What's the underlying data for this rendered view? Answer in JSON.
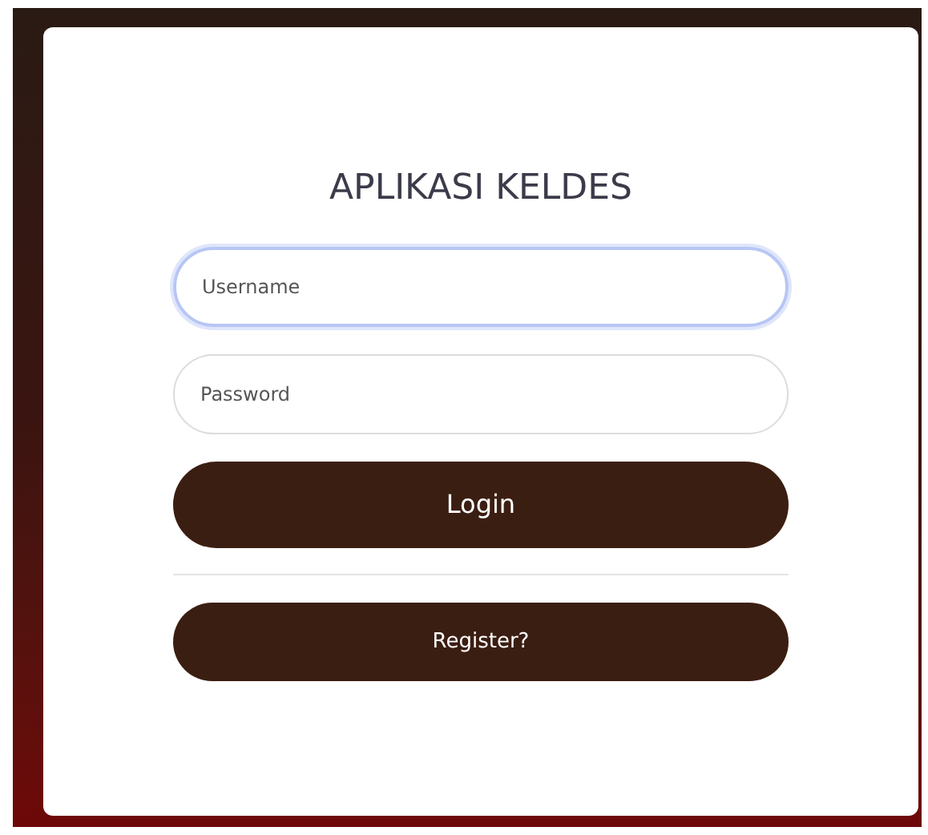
{
  "title": "APLIKASI KELDES",
  "fields": [
    {
      "placeholder": "Username",
      "focused": true
    },
    {
      "placeholder": "Password",
      "focused": false
    }
  ],
  "buttons": [
    {
      "label": "Login",
      "kind": "primary"
    },
    {
      "label": "Register?",
      "kind": "secondary"
    }
  ]
}
